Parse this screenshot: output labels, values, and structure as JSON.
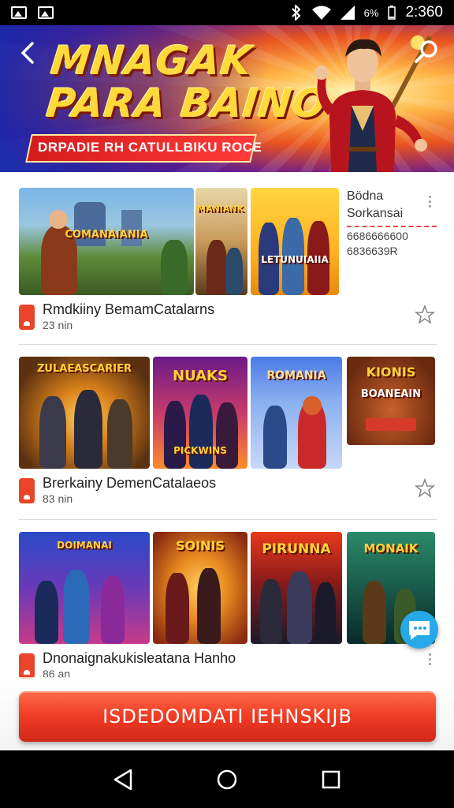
{
  "status_bar": {
    "icons": [
      "image-icon",
      "gallery-icon",
      "bluetooth-icon",
      "wifi-icon",
      "signal-icon"
    ],
    "battery": "6%",
    "time": "2:360"
  },
  "banner": {
    "title_line1": "MNAGAK",
    "title_line2": "PARA BAINO",
    "subtitle": "DRPADIE RH CATULLBIKU ROCE"
  },
  "sections": [
    {
      "thumbnails": [
        {
          "label": "COMANAIANIA"
        },
        {
          "label": "MANIANKS"
        },
        {
          "label": "LETUNUIAIIA"
        }
      ],
      "side_info": {
        "line1": "Bödna",
        "line2": "Sorkansai",
        "line3": "6686666600",
        "line4": "6836639R"
      },
      "title": "Rmdkiiny BemamCatalarns",
      "subtitle": "23 nin"
    },
    {
      "thumbnails": [
        {
          "label": "ZULAEASCARIER"
        },
        {
          "label": "NUAKS"
        },
        {
          "label": "ROMANIA"
        },
        {
          "label": "KIONIS"
        }
      ],
      "extra_labels": {
        "badge": "PICKWINS",
        "kionis_sub": "BOANEAIN"
      },
      "title": "Brerkainy DemenCatalaeos",
      "subtitle": "83 nin"
    },
    {
      "thumbnails": [
        {
          "label": "DOIMANAI"
        },
        {
          "label": "SOINIS"
        },
        {
          "label": "PIRUNNA"
        },
        {
          "label": "MONAIK"
        }
      ],
      "title": "Dnonaignakukisleatana Hanho",
      "subtitle": "86 an"
    }
  ],
  "cta": {
    "label": "ISDEDOMDATI IEHNSKIJB"
  },
  "colors": {
    "accent": "#ee3b24",
    "fab": "#27a9e8"
  }
}
